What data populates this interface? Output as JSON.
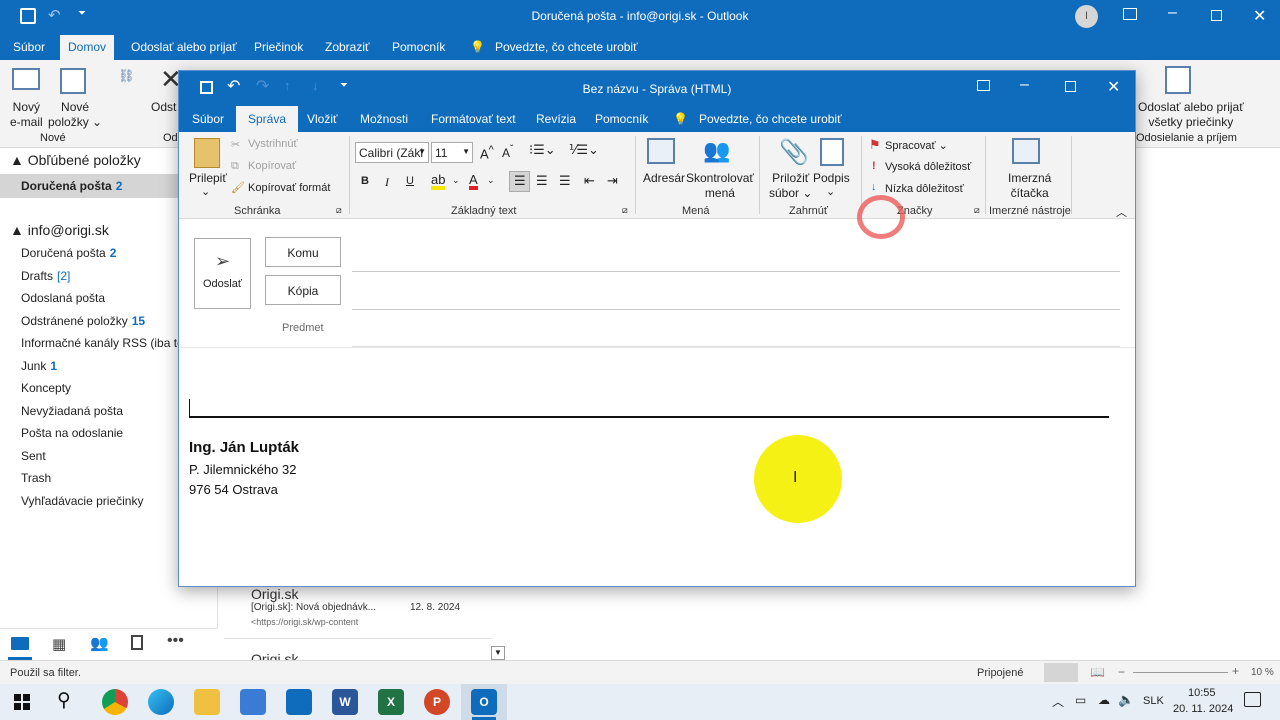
{
  "outlook": {
    "title": "Doručená pošta - info@origi.sk - Outlook",
    "avatar": "I",
    "menu": [
      "Súbor",
      "Domov",
      "Odoslať alebo prijať",
      "Priečinok",
      "Zobraziť",
      "Pomocník"
    ],
    "active_menu": "Domov",
    "tell_me": "Povedzte, čo chcete urobiť",
    "ribbon": {
      "new_email": "Nový\ne-mail",
      "new_email_l1": "Nový",
      "new_email_l2": "e-mail",
      "new_items_l1": "Nové",
      "new_items_l2": "položky",
      "group_new": "Nové",
      "delete_partial": "Odst",
      "group_partial": "Od",
      "send_all_l1": "Odoslať alebo prijať",
      "send_all_l2": "všetky priečinky",
      "group_send": "Odosielanie a príjem"
    },
    "favorites_header": "Obľúbené položky",
    "favorites": [
      {
        "name": "Doručená pošta",
        "count": "2"
      }
    ],
    "account": "info@origi.sk",
    "folders": [
      {
        "name": "Doručená pošta",
        "count": "2"
      },
      {
        "name": "Drafts",
        "count": "[2]"
      },
      {
        "name": "Odoslaná pošta",
        "count": ""
      },
      {
        "name": "Odstránené položky",
        "count": "15"
      },
      {
        "name": "Informačné kanály RSS (iba tent",
        "count": ""
      },
      {
        "name": "Junk",
        "count": "1"
      },
      {
        "name": "Koncepty",
        "count": ""
      },
      {
        "name": "Nevyžiadaná pošta",
        "count": ""
      },
      {
        "name": "Pošta na odoslanie",
        "count": ""
      },
      {
        "name": "Sent",
        "count": ""
      },
      {
        "name": "Trash",
        "count": ""
      },
      {
        "name": "Vyhľadávacie priečinky",
        "count": ""
      }
    ],
    "message_list": [
      {
        "sender": "Origi.sk",
        "subject": "[Origi.sk]: Nová objednávk...",
        "date": "12. 8. 2024",
        "preview": "<https://origi.sk/wp-content"
      },
      {
        "sender": "Origi.sk",
        "subject": "",
        "date": "",
        "preview": ""
      }
    ],
    "status_left": "Použil sa filter.",
    "status_right": "Pripojené",
    "zoom": "10 %"
  },
  "compose": {
    "title": "Bez názvu - Správa (HTML)",
    "tabs": [
      "Súbor",
      "Správa",
      "Vložiť",
      "Možnosti",
      "Formátovať text",
      "Revízia",
      "Pomocník"
    ],
    "active_tab": "Správa",
    "tell_me": "Povedzte, čo chcete urobiť",
    "clipboard": {
      "paste": "Prilepiť",
      "cut": "Vystrihnúť",
      "copy": "Kopírovať",
      "format_painter": "Kopírovať formát",
      "group": "Schránka"
    },
    "font": {
      "name": "Calibri (Zákl",
      "size": "11",
      "group": "Základný text"
    },
    "names": {
      "address_book": "Adresár",
      "check_l1": "Skontrolovať",
      "check_l2": "mená",
      "group": "Mená"
    },
    "include": {
      "attach_l1": "Priložiť",
      "attach_l2": "súbor",
      "signature": "Podpis",
      "group": "Zahrnúť"
    },
    "tags": {
      "followup": "Spracovať",
      "high": "Vysoká dôležitosť",
      "low": "Nízka dôležitosť",
      "group": "Značky"
    },
    "immersive": {
      "reader_l1": "Imerzná",
      "reader_l2": "čítačka",
      "group": "Imerzné nástroje"
    },
    "send": "Odoslať",
    "to": "Komu",
    "cc": "Kópia",
    "subject_label": "Predmet",
    "signature": {
      "name": "Ing. Ján Lupták",
      "street": "P. Jilemnického 32",
      "city": "976 54 Ostrava"
    }
  },
  "taskbar": {
    "lang": "SLK",
    "time": "10:55",
    "date": "20. 11. 2024"
  },
  "colors": {
    "accent": "#0f6cbd",
    "highlight": "#f5f000"
  }
}
